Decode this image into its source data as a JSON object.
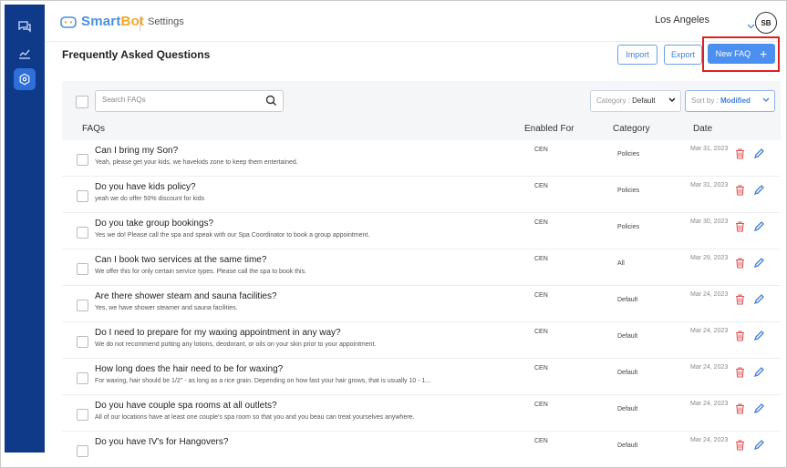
{
  "app": {
    "logo_smart": "Smart",
    "logo_bot": "Bot",
    "section": "Settings"
  },
  "header": {
    "location": "Los Angeles",
    "avatar_initials": "SB"
  },
  "page": {
    "title": "Frequently Asked Questions"
  },
  "buttons": {
    "import": "Import",
    "export": "Export",
    "new_faq": "New FAQ",
    "new_faq_icon": "+"
  },
  "search": {
    "placeholder": "Search FAQs"
  },
  "filters": {
    "category_label": "Category : ",
    "category_value": "Default",
    "sort_label": "Sort by : ",
    "sort_value": "Modified"
  },
  "table": {
    "headers": {
      "faqs": "FAQs",
      "enabled_for": "Enabled For",
      "category": "Category",
      "date": "Date"
    },
    "rows": [
      {
        "question": "Can I bring my Son?",
        "answer": "Yeah, please get your kids, we havekids zone to keep them entertained.",
        "enabled": "CEN",
        "category": "Policies",
        "date": "Mar 31, 2023"
      },
      {
        "question": "Do you have kids policy?",
        "answer": "yeah we do offer 50% discount for kids",
        "enabled": "CEN",
        "category": "Policies",
        "date": "Mar 31, 2023"
      },
      {
        "question": "Do you take group bookings?",
        "answer": "Yes we do! Please call the spa and speak with our Spa Coordinator to book a group appointment.",
        "enabled": "CEN",
        "category": "Policies",
        "date": "Mar 30, 2023"
      },
      {
        "question": "Can I book two services at the same time?",
        "answer": "We offer this for only certain service types. Please call the spa to book this.",
        "enabled": "CEN",
        "category": "All",
        "date": "Mar 29, 2023"
      },
      {
        "question": "Are there shower steam and sauna facilities?",
        "answer": "Yes, we have shower steamer and sauna facilities.",
        "enabled": "CEN",
        "category": "Default",
        "date": "Mar 24, 2023"
      },
      {
        "question": "Do I need to prepare for my waxing appointment in any way?",
        "answer": "We do not recommend putting any lotions, deodorant, or oils on your skin prior to your appointment.",
        "enabled": "CEN",
        "category": "Default",
        "date": "Mar 24, 2023"
      },
      {
        "question": "How long does the hair need to be for waxing?",
        "answer": "For waxing, hair should be 1/2\" - as long as a rice grain. Depending on how fast your hair grows, that is usually 10 - 1...",
        "enabled": "CEN",
        "category": "Default",
        "date": "Mar 24, 2023"
      },
      {
        "question": "Do you have couple spa rooms at all outlets?",
        "answer": "All of our locations have at least one couple's spa room so that you and you beau can treat yourselves anywhere.",
        "enabled": "CEN",
        "category": "Default",
        "date": "Mar 24, 2023"
      },
      {
        "question": "Do you have IV's for Hangovers?",
        "answer": "",
        "enabled": "CEN",
        "category": "Default",
        "date": "Mar 24, 2023"
      }
    ]
  },
  "colors": {
    "sidebar": "#0f3a8a",
    "accent": "#4b8ff0",
    "highlight": "#e02020",
    "delete": "#e05555",
    "edit": "#3f7fd6"
  },
  "icons": {
    "sidebar": [
      "chat-icon",
      "analytics-icon",
      "settings-icon"
    ],
    "row_actions": [
      "trash-icon",
      "pencil-icon"
    ]
  }
}
